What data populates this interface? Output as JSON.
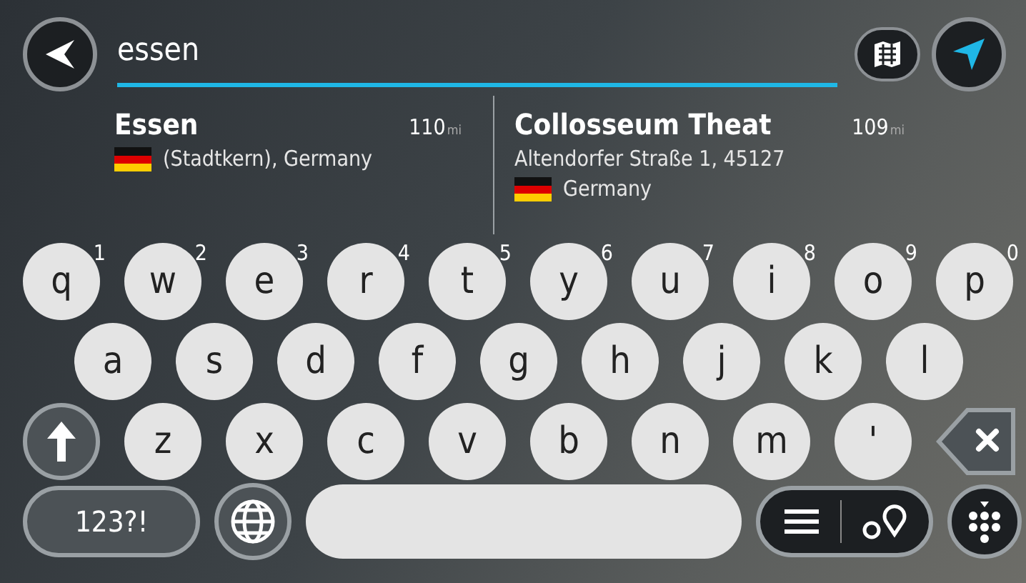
{
  "search": {
    "value": "essen"
  },
  "results": [
    {
      "title": "Essen",
      "distance": "110",
      "unit": "mi",
      "lines": [
        {
          "text": "(Stadtkern), Germany",
          "flag": true
        }
      ]
    },
    {
      "title": "Collosseum Theat",
      "distance": "109",
      "unit": "mi",
      "lines": [
        {
          "text": "Altendorfer Straße 1, 45127",
          "flag": false
        },
        {
          "text": "Germany",
          "flag": true
        }
      ]
    }
  ],
  "keyboard": {
    "rows": [
      [
        {
          "kind": "letter",
          "label": "q",
          "sup": "1"
        },
        {
          "kind": "letter",
          "label": "w",
          "sup": "2"
        },
        {
          "kind": "letter",
          "label": "e",
          "sup": "3"
        },
        {
          "kind": "letter",
          "label": "r",
          "sup": "4"
        },
        {
          "kind": "letter",
          "label": "t",
          "sup": "5"
        },
        {
          "kind": "letter",
          "label": "y",
          "sup": "6"
        },
        {
          "kind": "letter",
          "label": "u",
          "sup": "7"
        },
        {
          "kind": "letter",
          "label": "i",
          "sup": "8"
        },
        {
          "kind": "letter",
          "label": "o",
          "sup": "9"
        },
        {
          "kind": "letter",
          "label": "p",
          "sup": "0"
        }
      ],
      [
        {
          "kind": "letter",
          "label": "a"
        },
        {
          "kind": "letter",
          "label": "s"
        },
        {
          "kind": "letter",
          "label": "d"
        },
        {
          "kind": "letter",
          "label": "f"
        },
        {
          "kind": "letter",
          "label": "g"
        },
        {
          "kind": "letter",
          "label": "h"
        },
        {
          "kind": "letter",
          "label": "j"
        },
        {
          "kind": "letter",
          "label": "k"
        },
        {
          "kind": "letter",
          "label": "l"
        }
      ],
      [
        {
          "kind": "shift"
        },
        {
          "kind": "letter",
          "label": "z"
        },
        {
          "kind": "letter",
          "label": "x"
        },
        {
          "kind": "letter",
          "label": "c"
        },
        {
          "kind": "letter",
          "label": "v"
        },
        {
          "kind": "letter",
          "label": "b"
        },
        {
          "kind": "letter",
          "label": "n"
        },
        {
          "kind": "letter",
          "label": "m"
        },
        {
          "kind": "letter",
          "label": "'"
        },
        {
          "kind": "backspace"
        }
      ]
    ],
    "mode_key": "123?!"
  }
}
